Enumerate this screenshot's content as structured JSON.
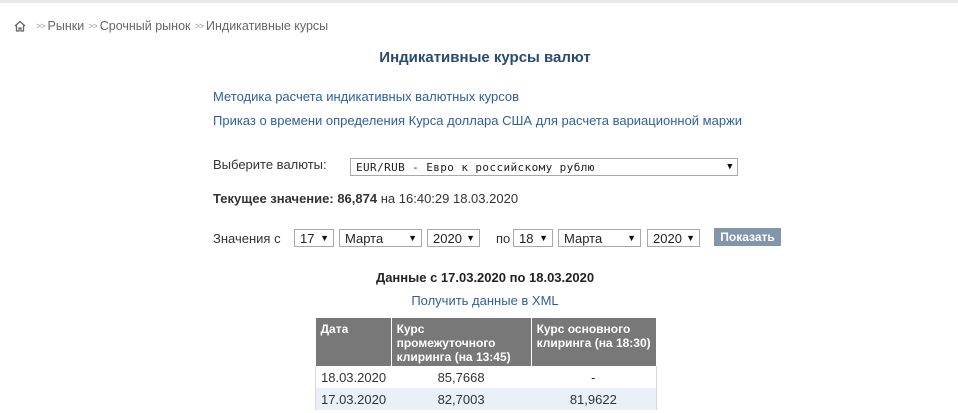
{
  "breadcrumb": {
    "items": [
      "Рынки",
      "Срочный рынок",
      "Индикативные курсы"
    ],
    "separator": ">>"
  },
  "title": "Индикативные курсы валют",
  "links": {
    "methodology": "Методика расчета индикативных валютных курсов",
    "order": "Приказ о времени определения Курса доллара США для расчета вариационной маржи"
  },
  "currency": {
    "label": "Выберите валюты:",
    "selected": "EUR/RUB - Евро к российскому рублю"
  },
  "current": {
    "label": "Текущее значение:",
    "value": "86,874",
    "at": "на",
    "time": "16:40:29 18.03.2020"
  },
  "dates": {
    "label_from": "Значения с",
    "from_day": "17",
    "from_month": "Марта",
    "from_year": "2020",
    "label_to": "по",
    "to_day": "18",
    "to_month": "Марта",
    "to_year": "2020",
    "show_button": "Показать"
  },
  "range_title": "Данные с 17.03.2020 по 18.03.2020",
  "xml_link": "Получить данные в XML",
  "table": {
    "headers": [
      "Дата",
      "Курс промежуточного клиринга (на 13:45)",
      "Курс основного клиринга (на 18:30)"
    ],
    "rows": [
      [
        "18.03.2020",
        "85,7668",
        "-"
      ],
      [
        "17.03.2020",
        "82,7003",
        "81,9622"
      ]
    ]
  },
  "colors": {
    "link": "#2f5f9a",
    "title": "#2b4a6f",
    "table_header": "#787878",
    "button": "#8296ab",
    "row_alt": "#eaf0f7"
  }
}
